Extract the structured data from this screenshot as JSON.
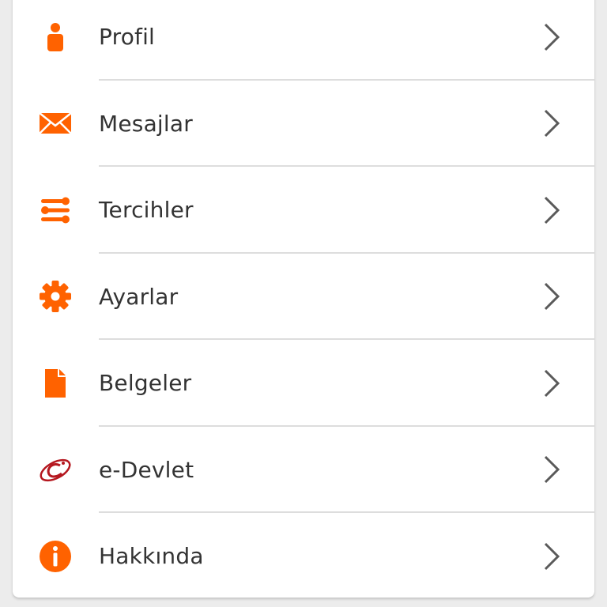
{
  "colors": {
    "accent": "#FF6200",
    "text": "#333333",
    "chevron": "#5a5a5a",
    "divider": "#dddddd",
    "edevlet": "#b5171f"
  },
  "menu": {
    "items": [
      {
        "label": "Profil",
        "icon": "person-icon"
      },
      {
        "label": "Mesajlar",
        "icon": "envelope-icon"
      },
      {
        "label": "Tercihler",
        "icon": "sliders-icon"
      },
      {
        "label": "Ayarlar",
        "icon": "gear-icon"
      },
      {
        "label": "Belgeler",
        "icon": "document-icon"
      },
      {
        "label": "e-Devlet",
        "icon": "edevlet-logo-icon"
      },
      {
        "label": "Hakkında",
        "icon": "info-icon"
      }
    ]
  }
}
